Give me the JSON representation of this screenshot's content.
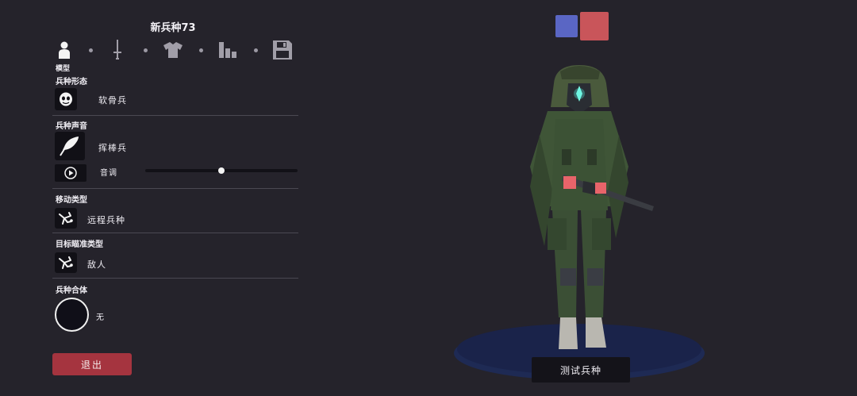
{
  "unit_title": "新兵种73",
  "tabs": [
    {
      "name": "model",
      "icon": "person-icon",
      "label": "模型",
      "active": true
    },
    {
      "name": "weapon",
      "icon": "sword-icon"
    },
    {
      "name": "clothing",
      "icon": "shirt-icon"
    },
    {
      "name": "stats",
      "icon": "bar-chart-icon"
    },
    {
      "name": "save",
      "icon": "floppy-disk-icon"
    }
  ],
  "sections": {
    "form": {
      "label": "兵种形态",
      "value": "软骨兵",
      "icon": "skull-mask-icon"
    },
    "voice": {
      "label": "兵种声音",
      "value": "挥棒兵",
      "icon": "feather-icon",
      "pitch_label": "音调",
      "pitch_value": 0.5
    },
    "movement": {
      "label": "移动类型",
      "value": "远程兵种",
      "icon": "falling-figure-icon"
    },
    "targeting": {
      "label": "目标瞄准类型",
      "value": "敌人",
      "icon": "falling-figure-icon"
    },
    "combo": {
      "label": "兵种合体",
      "value": "无"
    }
  },
  "buttons": {
    "exit": "退出",
    "test": "测试兵种"
  },
  "colors": {
    "team_blue": "#5a66c4",
    "team_red": "#c9555a",
    "exit_button": "#a5343f",
    "background": "#25232b"
  }
}
